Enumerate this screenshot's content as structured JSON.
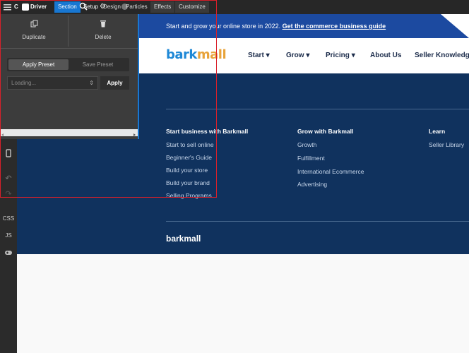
{
  "toolbar": {
    "menu_icon": "hamburger-icon",
    "app_prefix": "C",
    "app_name": "Driver",
    "tabs": [
      {
        "label": "Section",
        "active": true
      },
      {
        "label": "Setup"
      },
      {
        "label": "Design"
      },
      {
        "label": "Particles"
      },
      {
        "label": "Effects"
      },
      {
        "label": "Customize"
      }
    ]
  },
  "rail": {
    "items": [
      "preview-icon",
      "mobile-icon",
      "undo-icon",
      "redo-icon"
    ],
    "css_label": "CSS",
    "js_label": "JS",
    "game_icon": "gamepad-icon"
  },
  "panel": {
    "duplicate_label": "Duplicate",
    "delete_label": "Delete",
    "apply_preset_label": "Apply Preset",
    "save_preset_label": "Save Preset",
    "select_value": "Loading...",
    "apply_label": "Apply"
  },
  "site": {
    "banner_text": "Start and grow your online store in 2022.",
    "banner_link": "Get the commerce business guide",
    "logo_prefix": "bark",
    "logo_suffix": "mall",
    "nav": [
      {
        "label": "Start",
        "caret": "▾"
      },
      {
        "label": "Grow",
        "caret": "▾"
      },
      {
        "label": "Pricing",
        "caret": "▾"
      },
      {
        "label": "About Us",
        "caret": ""
      },
      {
        "label": "Seller Knowledge",
        "caret": ""
      }
    ],
    "footer": {
      "col1": {
        "title": "Start business with Barkmall",
        "links": [
          "Start to sell online",
          "Beginner's Guide",
          "Build your store",
          "Build your brand",
          "Selling Programs"
        ]
      },
      "col2": {
        "title": "Grow with Barkmall",
        "links": [
          "Growth",
          "Fulfillment",
          "International Ecommerce",
          "Advertising"
        ]
      },
      "col3": {
        "title": "Learn",
        "links": [
          "Seller Library"
        ]
      },
      "logo": "barkmall"
    }
  },
  "colors": {
    "accent": "#1877d2",
    "navy": "#10325e",
    "highlight": "#d9202a"
  }
}
